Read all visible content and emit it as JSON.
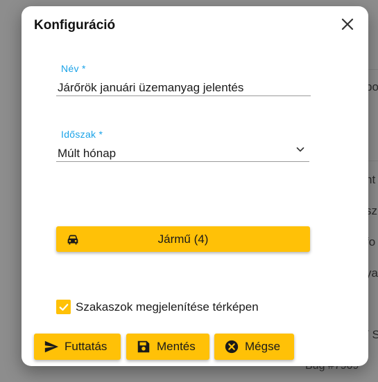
{
  "background": {
    "fragments": [
      "po",
      "nt",
      "sz",
      "fo",
      "ya",
      "/ S"
    ],
    "bug_label": "Bug #7909"
  },
  "dialog": {
    "title": "Konfiguráció",
    "name_field": {
      "label": "Név *",
      "value": "Járőrök januári üzemanyag jelentés"
    },
    "period_field": {
      "label": "Időszak *",
      "value": "Múlt hónap"
    },
    "vehicle_button": {
      "label": "Jármű (4)"
    },
    "show_sections_checkbox": {
      "label": "Szakaszok megjelenítése térképen",
      "checked": true
    },
    "actions": {
      "run": "Futtatás",
      "save": "Mentés",
      "cancel": "Mégse"
    }
  },
  "colors": {
    "accent": "#ffc107",
    "label_blue": "#1aa3e8"
  }
}
